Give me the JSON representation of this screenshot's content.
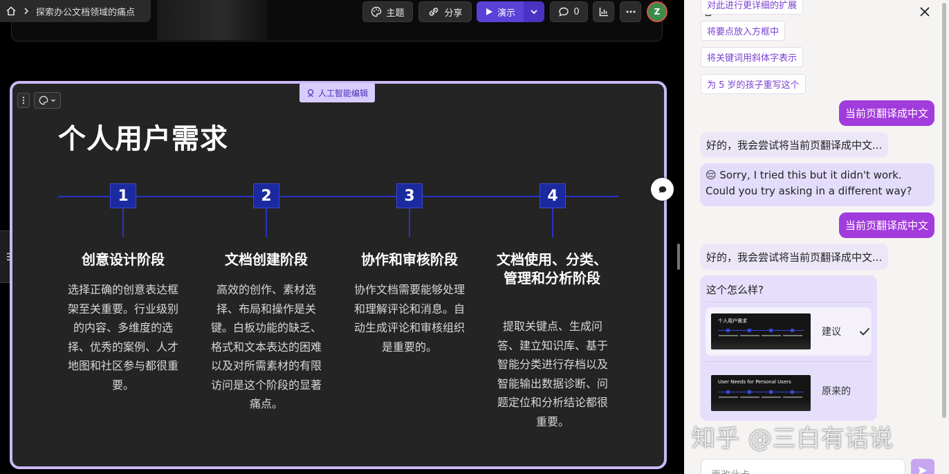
{
  "topbar": {
    "breadcrumb": "探索办公文档领域的痛点",
    "theme_label": "主题",
    "share_label": "分享",
    "present_label": "演示",
    "comment_count": "0",
    "avatar_initial": "Z"
  },
  "slide": {
    "ai_badge": "人工智能编辑",
    "title": "个人用户需求",
    "steps": [
      {
        "num": "1",
        "title": "创意设计阶段",
        "desc": "选择正确的创意表达框架至关重要。行业级别的内容、多维度的选择、优秀的案例、人才地图和社区参与都很重要。"
      },
      {
        "num": "2",
        "title": "文档创建阶段",
        "desc": "高效的创作、素材选择、布局和操作是关键。白板功能的缺乏、格式和文本表达的困难以及对所需素材的有限访问是这个阶段的显著痛点。"
      },
      {
        "num": "3",
        "title": "协作和审核阶段",
        "desc": "协作文档需要能够处理和理解评论和消息。自动生成评论和审核组织是重要的。"
      },
      {
        "num": "4",
        "title": "文档使用、分类、管理和分析阶段",
        "desc": "提取关键点、生成问答、建立知识库、基于智能分类进行存档以及智能输出数据诊断、问题定位和分析结论都很重要。"
      }
    ]
  },
  "panel": {
    "suggestions": [
      "对此进行更详细的扩展",
      "将要点放入方框中",
      "将关键词用斜体字表示",
      "为 5 岁的孩子重写这个"
    ],
    "messages": {
      "user1": "当前页翻译成中文",
      "bot1": "好的，我会尝试将当前页翻译成中文...",
      "bot_error_line1": "😔 Sorry, I tried this but it didn't work.",
      "bot_error_line2": "Could you try asking in a different way?",
      "user2": "当前页翻译成中文",
      "bot2": "好的，我会尝试将当前页翻译成中文..."
    },
    "card": {
      "question": "这个怎么样?",
      "option_suggested": "建议",
      "option_original": "原来的",
      "thumb_suggested_title": "个人用户需求",
      "thumb_original_title": "User Needs for Personal Users"
    },
    "input_placeholder": "更改此卡"
  },
  "watermark": "知乎 @三白有话说",
  "colors": {
    "accent_purple": "#a23bdc",
    "present_button": "#5b41d8",
    "timeline_blue": "#2a34c9",
    "slide_border": "#c9b8f5"
  }
}
